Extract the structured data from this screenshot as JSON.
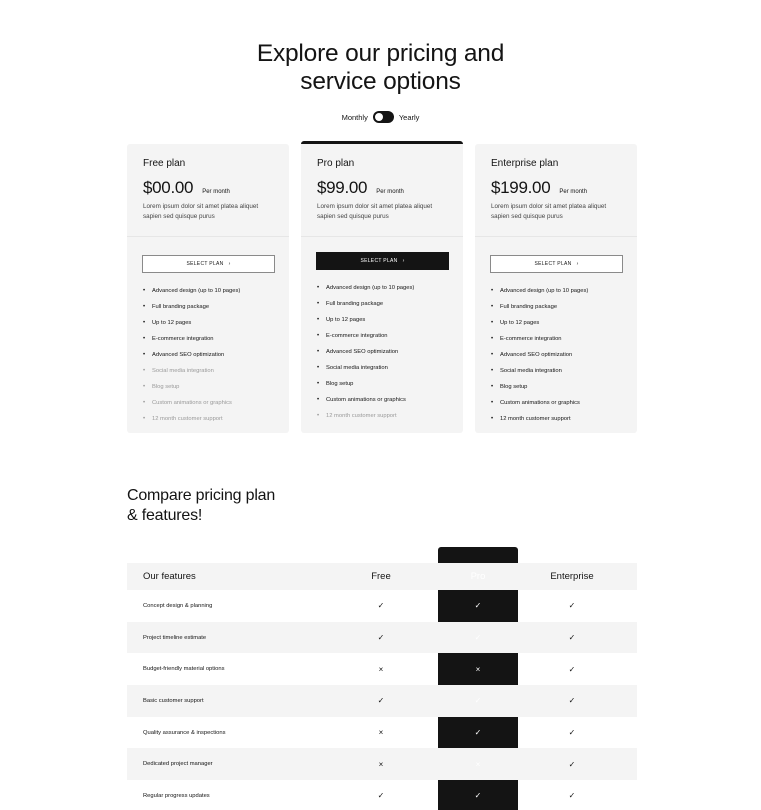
{
  "hero": {
    "title_line1": "Explore our pricing and",
    "title_line2": "service options"
  },
  "billing": {
    "monthly_label": "Monthly",
    "yearly_label": "Yearly",
    "selected": "Monthly"
  },
  "plans": [
    {
      "name": "Free plan",
      "price": "$00.00",
      "period": "Per month",
      "description": "Lorem ipsum dolor sit amet platea aliquet sapien sed quisque purus",
      "button_label": "SELECT PLAN",
      "featured": false,
      "features": [
        {
          "label": "Advanced design (up to 10 pages)",
          "included": true
        },
        {
          "label": "Full branding package",
          "included": true
        },
        {
          "label": "Up to 12 pages",
          "included": true
        },
        {
          "label": "E-commerce integration",
          "included": true
        },
        {
          "label": "Advanced SEO optimization",
          "included": true
        },
        {
          "label": "Social media integration",
          "included": false
        },
        {
          "label": "Blog setup",
          "included": false
        },
        {
          "label": "Custom animations or graphics",
          "included": false
        },
        {
          "label": "12 month customer support",
          "included": false
        }
      ]
    },
    {
      "name": "Pro plan",
      "price": "$99.00",
      "period": "Per month",
      "description": "Lorem ipsum dolor sit amet platea aliquet sapien sed quisque purus",
      "button_label": "SELECT PLAN",
      "featured": true,
      "features": [
        {
          "label": "Advanced design (up to 10 pages)",
          "included": true
        },
        {
          "label": "Full branding package",
          "included": true
        },
        {
          "label": "Up to 12 pages",
          "included": true
        },
        {
          "label": "E-commerce integration",
          "included": true
        },
        {
          "label": "Advanced SEO optimization",
          "included": true
        },
        {
          "label": "Social media integration",
          "included": true
        },
        {
          "label": "Blog setup",
          "included": true
        },
        {
          "label": "Custom animations or graphics",
          "included": true
        },
        {
          "label": "12 month customer support",
          "included": false
        }
      ]
    },
    {
      "name": "Enterprise plan",
      "price": "$199.00",
      "period": "Per month",
      "description": "Lorem ipsum dolor sit amet platea aliquet sapien sed quisque purus",
      "button_label": "SELECT PLAN",
      "featured": false,
      "features": [
        {
          "label": "Advanced design (up to 10 pages)",
          "included": true
        },
        {
          "label": "Full branding package",
          "included": true
        },
        {
          "label": "Up to 12 pages",
          "included": true
        },
        {
          "label": "E-commerce integration",
          "included": true
        },
        {
          "label": "Advanced SEO optimization",
          "included": true
        },
        {
          "label": "Social media integration",
          "included": true
        },
        {
          "label": "Blog setup",
          "included": true
        },
        {
          "label": "Custom animations or graphics",
          "included": true
        },
        {
          "label": "12 month customer support",
          "included": true
        }
      ]
    }
  ],
  "compare": {
    "title_line1": "Compare pricing plan",
    "title_line2": "& features!",
    "columns": [
      "Our features",
      "Free",
      "Pro",
      "Enterprise"
    ],
    "rows": [
      {
        "feature": "Concept design & planning",
        "free": "✓",
        "pro": "✓",
        "enterprise": "✓"
      },
      {
        "feature": "Project timeline estimate",
        "free": "✓",
        "pro": "✓",
        "enterprise": "✓"
      },
      {
        "feature": "Budget-friendly material options",
        "free": "×",
        "pro": "×",
        "enterprise": "✓"
      },
      {
        "feature": "Basic customer support",
        "free": "✓",
        "pro": "✓",
        "enterprise": "✓"
      },
      {
        "feature": "Quality assurance & inspections",
        "free": "×",
        "pro": "✓",
        "enterprise": "✓"
      },
      {
        "feature": "Dedicated project manager",
        "free": "×",
        "pro": "×",
        "enterprise": "✓"
      },
      {
        "feature": "Regular progress updates",
        "free": "✓",
        "pro": "✓",
        "enterprise": "✓"
      }
    ]
  },
  "colors": {
    "accent": "#141414",
    "card_bg": "#f4f4f4",
    "muted_text": "#9a9a9a"
  }
}
